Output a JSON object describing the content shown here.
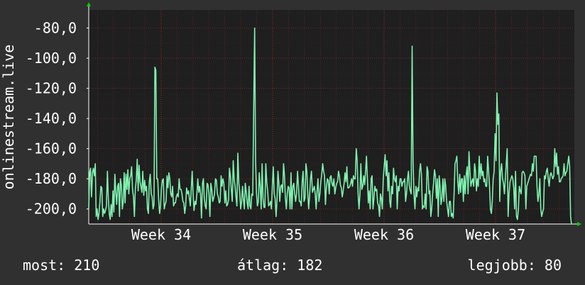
{
  "chart_data": {
    "type": "line",
    "ylabel": "onlinestream.live",
    "ylim": [
      -210,
      -68
    ],
    "yticks": [
      -80,
      -100,
      -120,
      -140,
      -160,
      -180,
      -200
    ],
    "ytick_labels": [
      "-80,0",
      "-100,0",
      "-120,0",
      "-140,0",
      "-160,0",
      "-180,0",
      "-200,0"
    ],
    "xticks": [
      "Week 34",
      "Week 35",
      "Week 36",
      "Week 37"
    ],
    "grid": true,
    "colors": {
      "line": "#7ff2b0",
      "background": "#303030",
      "plot": "#1f1f1f",
      "grid": "#ab2a2a",
      "axis": "#ffffff",
      "arrow": "#00d000"
    },
    "series": [
      {
        "values": [
          -200,
          -176,
          -173,
          -192,
          -176,
          -173,
          -178,
          -170,
          -205,
          -200,
          -207,
          -203,
          -195,
          -185,
          -186,
          -205,
          -200,
          -203,
          -201,
          -198,
          -175,
          -193,
          -203,
          -207,
          -197,
          -205,
          -188,
          -202,
          -177,
          -189,
          -197,
          -185,
          -183,
          -205,
          -180,
          -184,
          -200,
          -195,
          -176,
          -196,
          -177,
          -187,
          -174,
          -190,
          -180,
          -178,
          -172,
          -187,
          -192,
          -205,
          -187,
          -181,
          -167,
          -188,
          -171,
          -182,
          -185,
          -189,
          -175,
          -191,
          -181,
          -188,
          -185,
          -200,
          -203,
          -182,
          -177,
          -190,
          -192,
          -200,
          -197,
          -106,
          -108,
          -180,
          -180,
          -194,
          -203,
          -198,
          -186,
          -181,
          -180,
          -200,
          -197,
          -195,
          -178,
          -186,
          -176,
          -180,
          -190,
          -192,
          -185,
          -198,
          -196,
          -196,
          -192,
          -190,
          -192,
          -180,
          -187,
          -187,
          -190,
          -195,
          -196,
          -203,
          -198,
          -186,
          -190,
          -188,
          -193,
          -198,
          -187,
          -175,
          -190,
          -201,
          -195,
          -197,
          -190,
          -180,
          -189,
          -185,
          -190,
          -206,
          -183,
          -180,
          -193,
          -198,
          -200,
          -183,
          -184,
          -190,
          -205,
          -183,
          -187,
          -195,
          -193,
          -190,
          -180,
          -181,
          -190,
          -192,
          -196,
          -195,
          -178,
          -185,
          -180,
          -183,
          -196,
          -188,
          -198,
          -197,
          -194,
          -173,
          -178,
          -187,
          -195,
          -168,
          -180,
          -185,
          -192,
          -198,
          -163,
          -183,
          -189,
          -200,
          -195,
          -185,
          -194,
          -200,
          -183,
          -189,
          -196,
          -200,
          -185,
          -198,
          -200,
          -190,
          -191,
          -130,
          -80,
          -168,
          -190,
          -198,
          -195,
          -176,
          -185,
          -200,
          -170,
          -193,
          -199,
          -199,
          -170,
          -182,
          -188,
          -198,
          -197,
          -195,
          -200,
          -185,
          -172,
          -190,
          -193,
          -205,
          -194,
          -175,
          -183,
          -195,
          -185,
          -184,
          -189,
          -170,
          -178,
          -193,
          -200,
          -190,
          -185,
          -186,
          -200,
          -176,
          -200,
          -185,
          -183,
          -190,
          -195,
          -190,
          -175,
          -185,
          -195,
          -195,
          -198,
          -182,
          -175,
          -195,
          -193,
          -170,
          -175,
          -190,
          -200,
          -191,
          -180,
          -175,
          -189,
          -187,
          -185,
          -190,
          -200,
          -188,
          -180,
          -195,
          -190,
          -182,
          -177,
          -170,
          -175,
          -178,
          -197,
          -186,
          -180,
          -181,
          -190,
          -179,
          -178,
          -183,
          -185,
          -180,
          -190,
          -186,
          -183,
          -182,
          -175,
          -178,
          -184,
          -186,
          -192,
          -188,
          -183,
          -176,
          -182,
          -172,
          -186,
          -186,
          -185,
          -183,
          -180,
          -185,
          -178,
          -180,
          -180,
          -160,
          -168,
          -190,
          -200,
          -190,
          -170,
          -187,
          -185,
          -178,
          -184,
          -175,
          -165,
          -180,
          -196,
          -188,
          -200,
          -180,
          -178,
          -200,
          -193,
          -185,
          -188,
          -187,
          -196,
          -198,
          -205,
          -190,
          -193,
          -200,
          -180,
          -172,
          -164,
          -178,
          -168,
          -188,
          -176,
          -195,
          -199,
          -185,
          -190,
          -173,
          -180,
          -182,
          -178,
          -200,
          -185,
          -188,
          -180,
          -180,
          -185,
          -182,
          -182,
          -180,
          -195,
          -190,
          -180,
          -175,
          -185,
          -188,
          -190,
          -92,
          -168,
          -190,
          -200,
          -185,
          -192,
          -186,
          -188,
          -175,
          -170,
          -177,
          -200,
          -198,
          -199,
          -190,
          -200,
          -172,
          -175,
          -190,
          -188,
          -205,
          -200,
          -190,
          -183,
          -174,
          -178,
          -193,
          -180,
          -205,
          -178,
          -185,
          -197,
          -193,
          -180,
          -195,
          -180,
          -185,
          -195,
          -200,
          -205,
          -195,
          -195,
          -205,
          -203,
          -206,
          -190,
          -170,
          -168,
          -165,
          -182,
          -190,
          -177,
          -189,
          -180,
          -180,
          -195,
          -178,
          -190,
          -177,
          -172,
          -190,
          -162,
          -175,
          -185,
          -182,
          -180,
          -185,
          -170,
          -175,
          -188,
          -180,
          -185,
          -165,
          -180,
          -170,
          -178,
          -175,
          -182,
          -180,
          -185,
          -185,
          -165,
          -175,
          -185,
          -200,
          -203,
          -195,
          -180,
          -175,
          -150,
          -168,
          -123,
          -144,
          -137,
          -195,
          -175,
          -170,
          -180,
          -183,
          -190,
          -180,
          -170,
          -160,
          -205,
          -190,
          -182,
          -180,
          -178,
          -180,
          -186,
          -200,
          -175,
          -205,
          -207,
          -200,
          -185,
          -188,
          -190,
          -176,
          -175,
          -176,
          -178,
          -200,
          -185,
          -183,
          -181,
          -179,
          -177,
          -178,
          -170,
          -175,
          -165,
          -165,
          -165,
          -185,
          -195,
          -190,
          -180,
          -200,
          -205,
          -202,
          -200,
          -178,
          -180,
          -175,
          -173,
          -180,
          -185,
          -178,
          -176,
          -178,
          -180,
          -178,
          -160,
          -172,
          -163,
          -177,
          -172,
          -182,
          -182,
          -180,
          -179,
          -178,
          -170,
          -178,
          -176,
          -175,
          -170,
          -165,
          -172,
          -205,
          -210
        ]
      }
    ]
  },
  "stats": {
    "current": "most: 210",
    "average": "átlag: 182",
    "best": "legjobb: 80"
  }
}
